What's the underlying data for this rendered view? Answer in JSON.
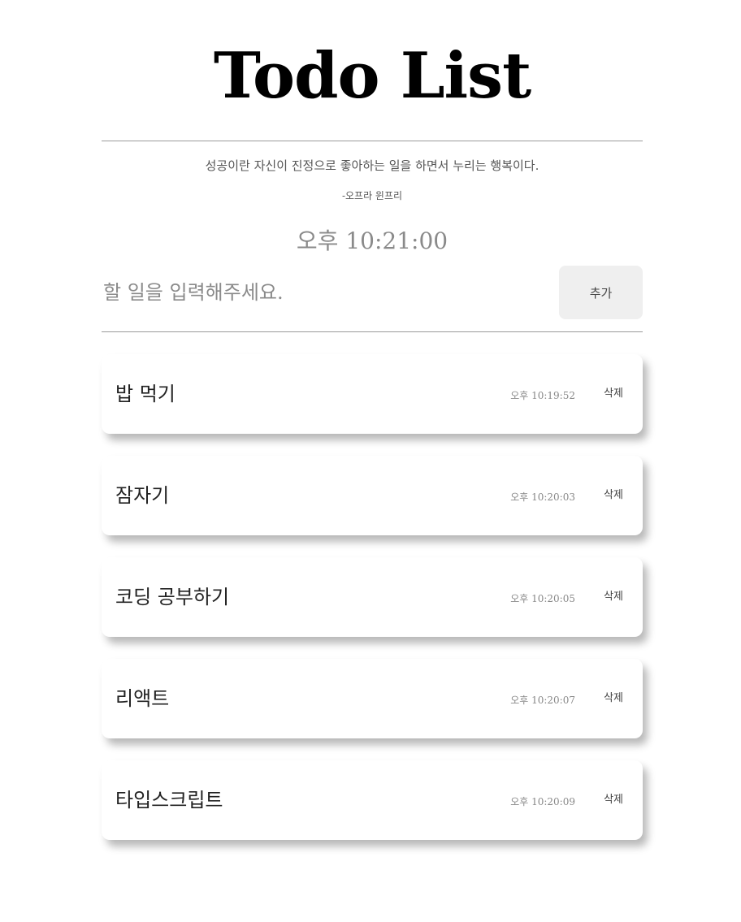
{
  "header": {
    "title": "Todo List"
  },
  "quote": {
    "text": "성공이란 자신이 진정으로 좋아하는 일을 하면서 누리는 행복이다.",
    "author": "-오프라 윈프리"
  },
  "clock": {
    "time": "오후 10:21:00"
  },
  "input": {
    "placeholder": "할 일을 입력해주세요.",
    "value": "",
    "add_label": "추가"
  },
  "todos": [
    {
      "text": "밥 먹기",
      "time": "오후 10:19:52",
      "delete_label": "삭제"
    },
    {
      "text": "잠자기",
      "time": "오후 10:20:03",
      "delete_label": "삭제"
    },
    {
      "text": "코딩 공부하기",
      "time": "오후 10:20:05",
      "delete_label": "삭제"
    },
    {
      "text": "리액트",
      "time": "오후 10:20:07",
      "delete_label": "삭제"
    },
    {
      "text": "타입스크립트",
      "time": "오후 10:20:09",
      "delete_label": "삭제"
    }
  ]
}
